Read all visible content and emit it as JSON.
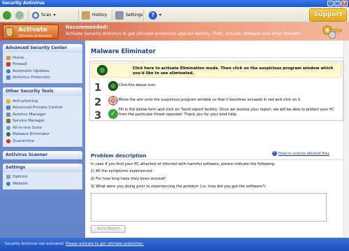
{
  "window": {
    "title": "Security Antivirus"
  },
  "toolbar": {
    "scan_label": "Scan",
    "history_label": "History",
    "settings_label": "Settings",
    "support_label": "Support"
  },
  "banner": {
    "activate_title": "Activate",
    "activate_subtitle": "Ultimate protection",
    "recommended_title": "Recommended:",
    "recommended_text": "Activate Security Antivirus to get ultimate protection against Identity Theft, Viruses, Malware and other threats!"
  },
  "sidebar": {
    "advanced_center": {
      "title": "Advanced Security Center",
      "items": [
        "Home",
        "Firewall",
        "Automatic Updates",
        "Antivirus Protection"
      ]
    },
    "other_tools": {
      "title": "Other Security Tools",
      "items": [
        "Anti-phishing",
        "Advanced Process Control",
        "Autorun Manager",
        "Service Manager",
        "All-in-one Suite",
        "Malware Eliminator",
        "Quarantine"
      ]
    },
    "scanner": {
      "title": "Antivirus Scanner"
    },
    "settings": {
      "title": "Settings",
      "items": [
        "Options",
        "Website"
      ]
    }
  },
  "main": {
    "title": "Malware Eliminator",
    "click_banner": "Click here to activate Elimination mode. Then click on the suspicious program window which you'd like to see eliminated.",
    "steps": [
      {
        "num": "1",
        "text": "Click the above icon."
      },
      {
        "num": "2",
        "text": "Move the aim onto the suspicious program window so that it becomes encased in red and click on it."
      },
      {
        "num": "3",
        "text": "Fill in the below form and click on 'Send report'-button. Once we receive your report, we will be able to protect your PC from the particular threat reported. Thank you for your kind help."
      }
    ],
    "description_title": "Problem description",
    "restore_link": "How to restore deleted files",
    "intro": "In case if you find your PC attacked of infected with harmful software, please indicate the following:",
    "questions": [
      "1) All the symptoms experienced",
      "2) For how long have they been around?",
      "3) What were you doing prior to experiencing the problem (i.e. how did you get the software?)"
    ],
    "send_button": "Send Report"
  },
  "status": {
    "text": "Security Antivirus not activated.",
    "link": "Please activate to get ultimate protection."
  },
  "colors": {
    "accent": "#1c3f95",
    "sidebar": "#6c89cc",
    "banner": "#d9673f",
    "support": "#f0b730"
  }
}
